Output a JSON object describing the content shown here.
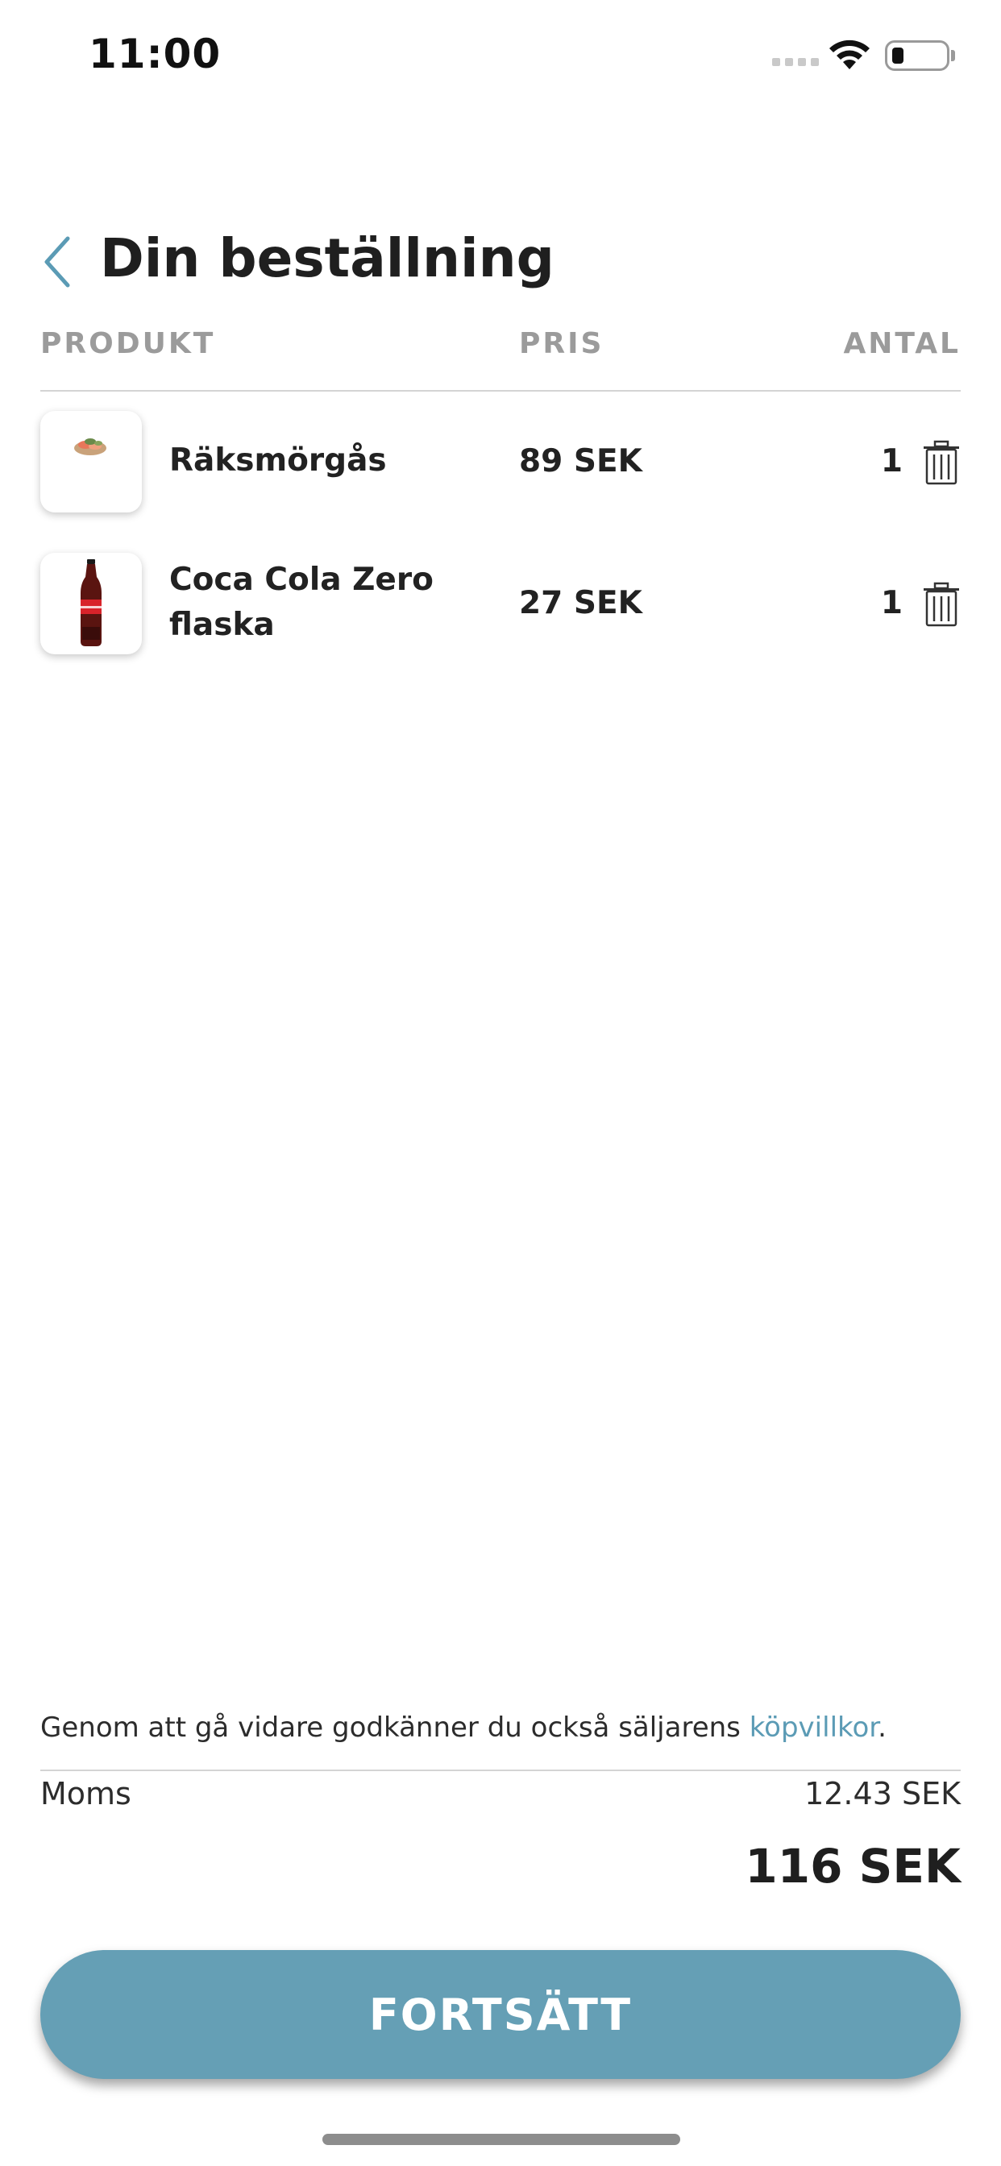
{
  "status_bar": {
    "time": "11:00"
  },
  "header": {
    "title": "Din beställning"
  },
  "table": {
    "columns": {
      "product": "PRODUKT",
      "price": "PRIS",
      "quantity": "ANTAL"
    },
    "items": [
      {
        "name": "Räksmörgås",
        "price": "89 SEK",
        "quantity": "1",
        "image_icon": "shrimp-sandwich-image"
      },
      {
        "name": "Coca Cola Zero flaska",
        "price": "27 SEK",
        "quantity": "1",
        "image_icon": "cola-bottle-image"
      }
    ]
  },
  "footer": {
    "terms_text": "Genom att gå vidare godkänner du också säljarens ",
    "terms_link": "köpvillkor",
    "terms_end": ".",
    "vat_label": "Moms",
    "vat_value": "12.43 SEK",
    "total": "116 SEK",
    "continue_label": "FORTSÄTT"
  },
  "colors": {
    "accent": "#659fb5",
    "link": "#5b9bb5",
    "muted": "#9b9b9b"
  }
}
